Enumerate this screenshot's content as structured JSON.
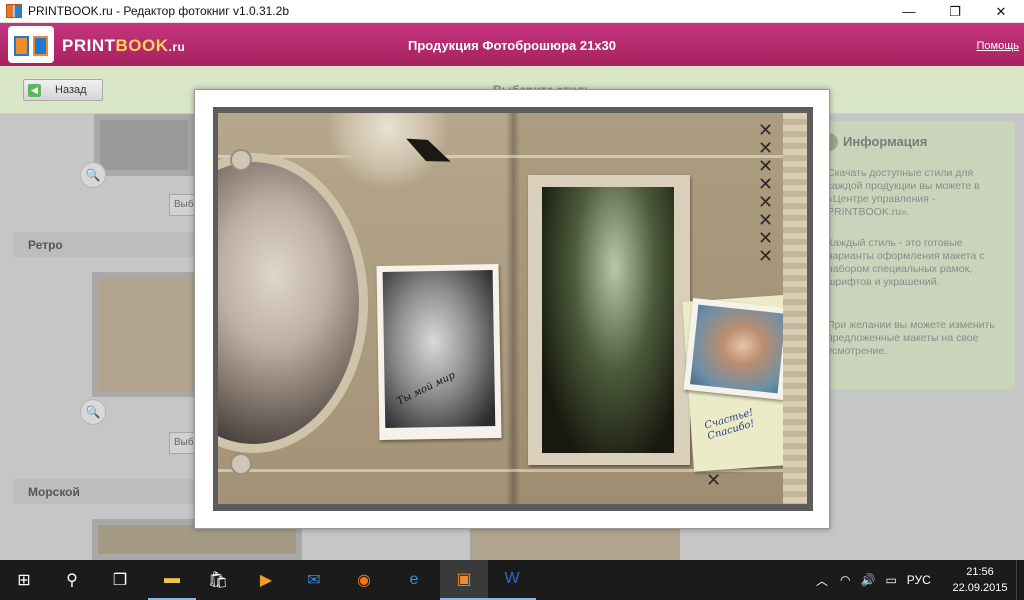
{
  "window": {
    "title": "PRINTBOOK.ru - Редактор фотокниг v1.0.31.2b",
    "controls": {
      "minimize": "—",
      "maximize": "❐",
      "close": "✕"
    }
  },
  "header": {
    "brand_main": "PRINT",
    "brand_accent": "BOOK",
    "brand_suffix": ".ru",
    "title": "Продукция Фотоброшюра 21х30",
    "help": "Помощь"
  },
  "toolbar": {
    "back_label": "Назад",
    "page_title": "Выберите стиль"
  },
  "styles": {
    "sections": [
      "Ретро",
      "Морской"
    ],
    "select_label": "Выбрать"
  },
  "info": {
    "title": "Информация",
    "paragraphs": [
      "Скачать доступные стили для каждой продукции вы можете в «Центре управления - PRINTBOOK.ru».",
      "Каждый стиль - это готовые варианты оформления макета с набором специальных рамок, шрифтов и украшений.",
      "При желании вы можете изменить предложенные макеты на свое усмотрение."
    ]
  },
  "preview": {
    "note_left": "Ты мой мир",
    "note_right": "Счастье! Спасибо!"
  },
  "taskbar": {
    "lang": "РУС",
    "time": "21:56",
    "date": "22.09.2015"
  },
  "colors": {
    "header": "#b02a6c",
    "accent_green": "#d9e6c8",
    "taskbar": "#1b1b1b"
  }
}
